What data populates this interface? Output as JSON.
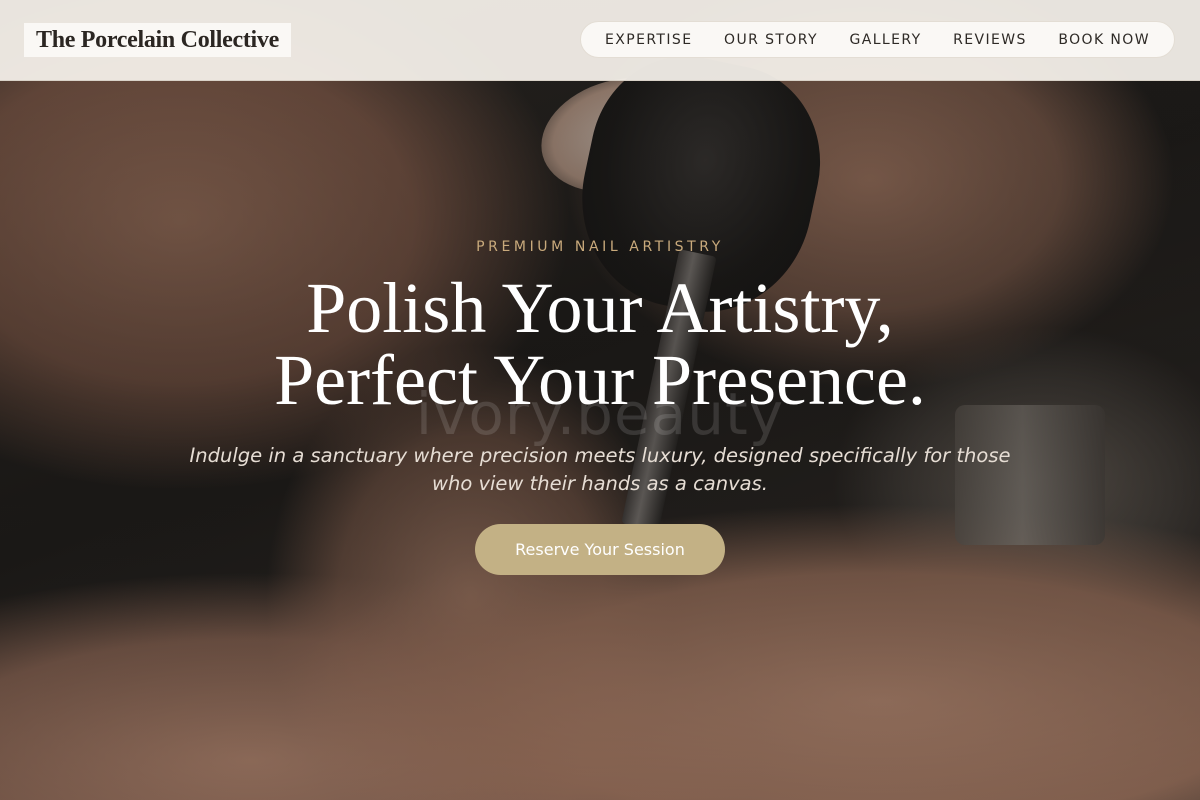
{
  "brand": {
    "name": "The Porcelain Collective"
  },
  "nav": {
    "items": [
      {
        "label": "EXPERTISE"
      },
      {
        "label": "OUR STORY"
      },
      {
        "label": "GALLERY"
      },
      {
        "label": "REVIEWS"
      },
      {
        "label": "BOOK NOW"
      }
    ]
  },
  "hero": {
    "eyebrow": "PREMIUM NAIL ARTISTRY",
    "headline_line1": "Polish Your Artistry,",
    "headline_line2": "Perfect Your Presence.",
    "subtext": "Indulge in a sanctuary where precision meets luxury, designed specifically for those who view their hands as a canvas.",
    "cta_label": "Reserve Your Session",
    "watermark": "ivory.beauty"
  },
  "colors": {
    "accent_gold": "#c3b185",
    "eyebrow": "#c9aa7c",
    "header_bg": "#f4f0ea",
    "brand_text": "#2b2622"
  }
}
